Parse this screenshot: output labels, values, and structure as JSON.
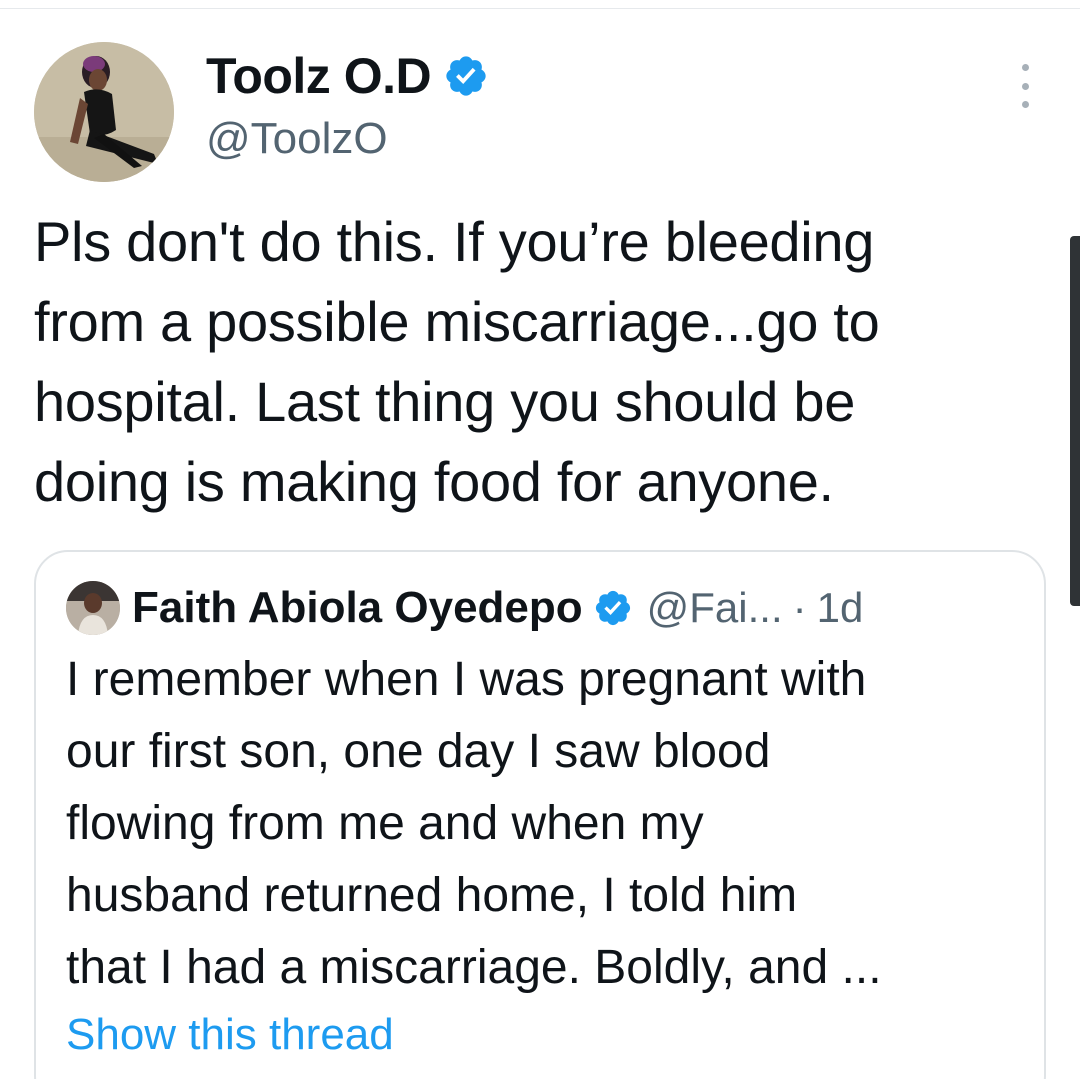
{
  "tweet": {
    "author": {
      "display_name": "Toolz O.D",
      "handle": "@ToolzO",
      "verified": true,
      "avatar_icon": "profile-photo"
    },
    "text_lines": [
      "Pls don't do this. If you’re bleeding",
      "from a possible miscarriage...go to",
      "hospital. Last thing you should be",
      "doing is making food for anyone."
    ],
    "menu_icon": "more-vertical-icon"
  },
  "quoted_tweet": {
    "author": {
      "display_name": "Faith Abiola Oyedepo",
      "handle": "@Fai...",
      "verified": true,
      "avatar_icon": "profile-photo"
    },
    "separator": "·",
    "time": "1d",
    "text_lines": [
      "I remember when I was pregnant with",
      "our first son, one day I saw blood",
      "flowing from me and when my",
      "husband returned home, I told him",
      "that I had a miscarriage. Boldly, and ..."
    ],
    "show_thread_label": "Show this thread"
  },
  "colors": {
    "text_primary": "#0f1419",
    "text_secondary": "#536471",
    "link": "#1d9bf0",
    "verified_badge": "#1d9bf0",
    "border": "#dfe3e6"
  }
}
